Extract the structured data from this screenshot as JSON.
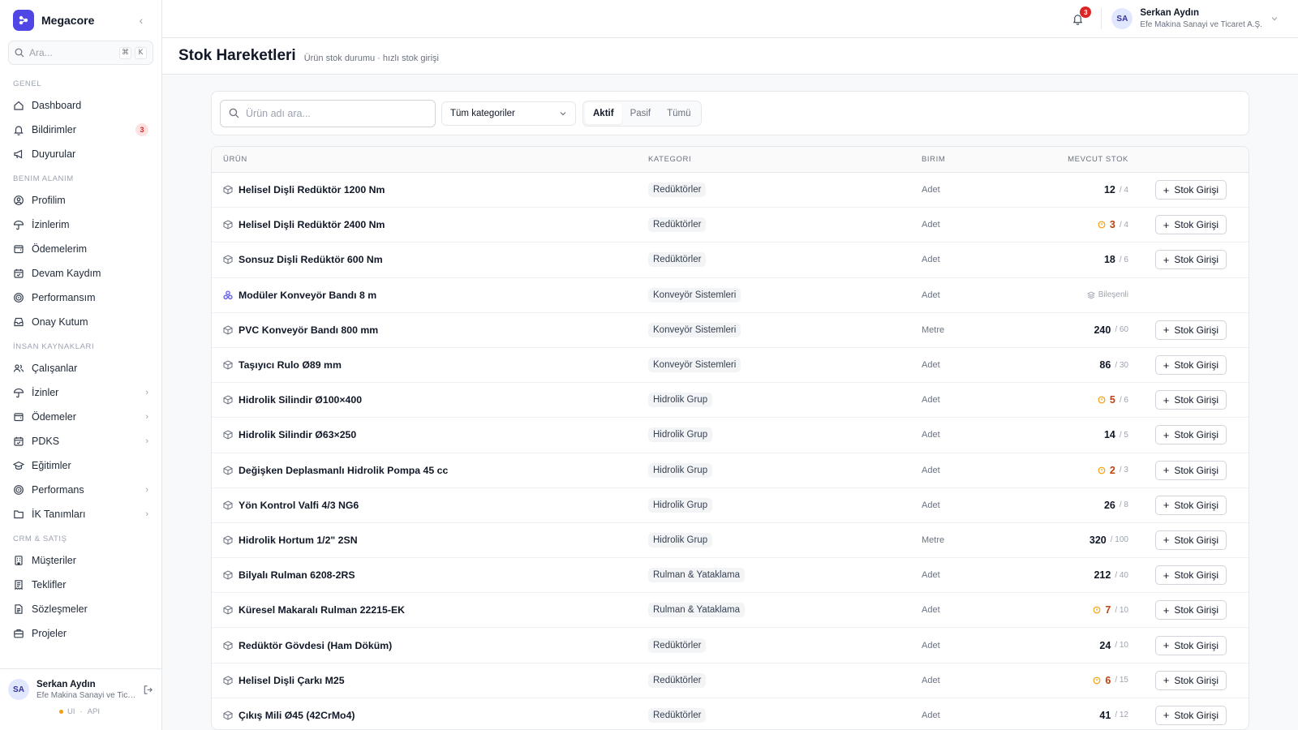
{
  "app": {
    "name": "Megacore"
  },
  "sidebar": {
    "search_placeholder": "Ara...",
    "shortcut_keys": [
      "⌘",
      "K"
    ],
    "sections": [
      {
        "title": "Genel",
        "items": [
          {
            "label": "Dashboard",
            "icon": "home-icon"
          },
          {
            "label": "Bildirimler",
            "icon": "bell-icon",
            "badge": "3"
          },
          {
            "label": "Duyurular",
            "icon": "megaphone-icon"
          }
        ]
      },
      {
        "title": "Benim Alanım",
        "items": [
          {
            "label": "Profilim",
            "icon": "user-circle-icon"
          },
          {
            "label": "İzinlerim",
            "icon": "umbrella-icon"
          },
          {
            "label": "Ödemelerim",
            "icon": "wallet-icon"
          },
          {
            "label": "Devam Kaydım",
            "icon": "calendar-check-icon"
          },
          {
            "label": "Performansım",
            "icon": "target-icon"
          },
          {
            "label": "Onay Kutum",
            "icon": "inbox-icon"
          }
        ]
      },
      {
        "title": "İnsan Kaynakları",
        "items": [
          {
            "label": "Çalışanlar",
            "icon": "users-icon"
          },
          {
            "label": "İzinler",
            "icon": "umbrella-icon",
            "chevron": true
          },
          {
            "label": "Ödemeler",
            "icon": "wallet-icon",
            "chevron": true
          },
          {
            "label": "PDKS",
            "icon": "calendar-check-icon",
            "chevron": true
          },
          {
            "label": "Eğitimler",
            "icon": "graduation-cap-icon"
          },
          {
            "label": "Performans",
            "icon": "target-icon",
            "chevron": true
          },
          {
            "label": "İK Tanımları",
            "icon": "folder-icon",
            "chevron": true
          }
        ]
      },
      {
        "title": "CRM & Satış",
        "items": [
          {
            "label": "Müşteriler",
            "icon": "building-icon"
          },
          {
            "label": "Teklifler",
            "icon": "receipt-icon"
          },
          {
            "label": "Sözleşmeler",
            "icon": "document-icon"
          },
          {
            "label": "Projeler",
            "icon": "briefcase-icon"
          }
        ]
      }
    ],
    "user": {
      "initials": "SA",
      "name": "Serkan Aydın",
      "company": "Efe Makina Sanayi ve Ticaret A.Ş.",
      "status_ui": "UI",
      "status_api": "API"
    }
  },
  "topbar": {
    "notification_count": "3",
    "user": {
      "initials": "SA",
      "name": "Serkan Aydın",
      "company": "Efe Makina Sanayi ve Ticaret A.Ş."
    }
  },
  "page": {
    "title": "Stok Hareketleri",
    "subtitle": "Ürün stok durumu · hızlı stok girişi"
  },
  "filters": {
    "search_placeholder": "Ürün adı ara...",
    "category_selected": "Tüm kategoriler",
    "status_options": [
      "Aktif",
      "Pasif",
      "Tümü"
    ],
    "status_active": "Aktif"
  },
  "table": {
    "columns": [
      "Ürün",
      "Kategori",
      "Birim",
      "Mevcut Stok"
    ],
    "action_label": "Stok Girişi",
    "bundle_label": "Bileşenli",
    "rows": [
      {
        "product": "Helisel Dişli Redüktör 1200 Nm",
        "category": "Redüktörler",
        "unit": "Adet",
        "stock": "12",
        "min": "/ 4",
        "low": false
      },
      {
        "product": "Helisel Dişli Redüktör 2400 Nm",
        "category": "Redüktörler",
        "unit": "Adet",
        "stock": "3",
        "min": "/ 4",
        "low": true
      },
      {
        "product": "Sonsuz Dişli Redüktör 600 Nm",
        "category": "Redüktörler",
        "unit": "Adet",
        "stock": "18",
        "min": "/ 6",
        "low": false
      },
      {
        "product": "Modüler Konveyör Bandı 8 m",
        "category": "Konveyör Sistemleri",
        "unit": "Adet",
        "bundle": true
      },
      {
        "product": "PVC Konveyör Bandı 800 mm",
        "category": "Konveyör Sistemleri",
        "unit": "Metre",
        "stock": "240",
        "min": "/ 60",
        "low": false
      },
      {
        "product": "Taşıyıcı Rulo Ø89 mm",
        "category": "Konveyör Sistemleri",
        "unit": "Adet",
        "stock": "86",
        "min": "/ 30",
        "low": false
      },
      {
        "product": "Hidrolik Silindir Ø100×400",
        "category": "Hidrolik Grup",
        "unit": "Adet",
        "stock": "5",
        "min": "/ 6",
        "low": true
      },
      {
        "product": "Hidrolik Silindir Ø63×250",
        "category": "Hidrolik Grup",
        "unit": "Adet",
        "stock": "14",
        "min": "/ 5",
        "low": false
      },
      {
        "product": "Değişken Deplasmanlı Hidrolik Pompa 45 cc",
        "category": "Hidrolik Grup",
        "unit": "Adet",
        "stock": "2",
        "min": "/ 3",
        "low": true
      },
      {
        "product": "Yön Kontrol Valfi 4/3 NG6",
        "category": "Hidrolik Grup",
        "unit": "Adet",
        "stock": "26",
        "min": "/ 8",
        "low": false
      },
      {
        "product": "Hidrolik Hortum 1/2\" 2SN",
        "category": "Hidrolik Grup",
        "unit": "Metre",
        "stock": "320",
        "min": "/ 100",
        "low": false
      },
      {
        "product": "Bilyalı Rulman 6208-2RS",
        "category": "Rulman & Yataklama",
        "unit": "Adet",
        "stock": "212",
        "min": "/ 40",
        "low": false
      },
      {
        "product": "Küresel Makaralı Rulman 22215-EK",
        "category": "Rulman & Yataklama",
        "unit": "Adet",
        "stock": "7",
        "min": "/ 10",
        "low": true
      },
      {
        "product": "Redüktör Gövdesi (Ham Döküm)",
        "category": "Redüktörler",
        "unit": "Adet",
        "stock": "24",
        "min": "/ 10",
        "low": false
      },
      {
        "product": "Helisel Dişli Çarkı M25",
        "category": "Redüktörler",
        "unit": "Adet",
        "stock": "6",
        "min": "/ 15",
        "low": true
      },
      {
        "product": "Çıkış Mili Ø45 (42CrMo4)",
        "category": "Redüktörler",
        "unit": "Adet",
        "stock": "41",
        "min": "/ 12",
        "low": false
      }
    ]
  },
  "colors": {
    "brand": "#4f46e5",
    "badge_red": "#dc2626",
    "low_stock": "#c2410c",
    "warning": "#f59e0b"
  }
}
